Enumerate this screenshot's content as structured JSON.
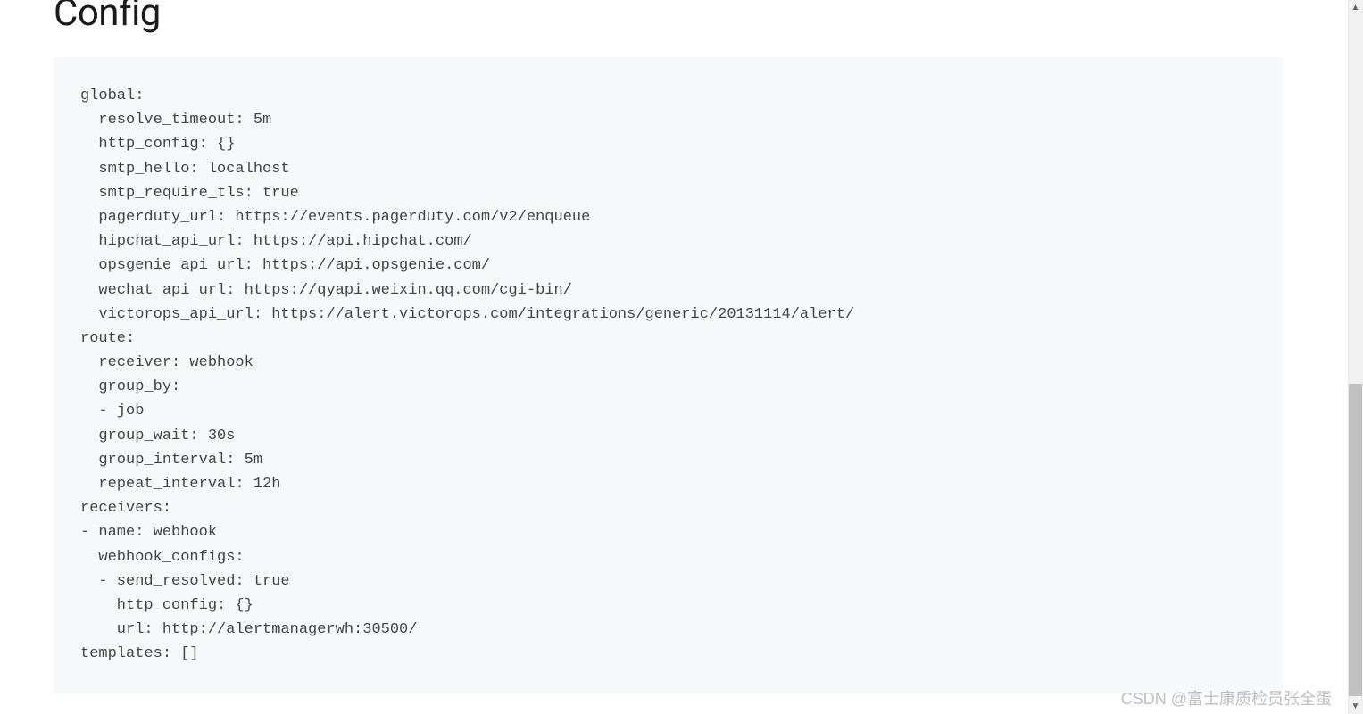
{
  "page": {
    "title": "Config"
  },
  "config_yaml": "global:\n  resolve_timeout: 5m\n  http_config: {}\n  smtp_hello: localhost\n  smtp_require_tls: true\n  pagerduty_url: https://events.pagerduty.com/v2/enqueue\n  hipchat_api_url: https://api.hipchat.com/\n  opsgenie_api_url: https://api.opsgenie.com/\n  wechat_api_url: https://qyapi.weixin.qq.com/cgi-bin/\n  victorops_api_url: https://alert.victorops.com/integrations/generic/20131114/alert/\nroute:\n  receiver: webhook\n  group_by:\n  - job\n  group_wait: 30s\n  group_interval: 5m\n  repeat_interval: 12h\nreceivers:\n- name: webhook\n  webhook_configs:\n  - send_resolved: true\n    http_config: {}\n    url: http://alertmanagerwh:30500/\ntemplates: []",
  "watermark": "CSDN @富士康质检员张全蛋"
}
